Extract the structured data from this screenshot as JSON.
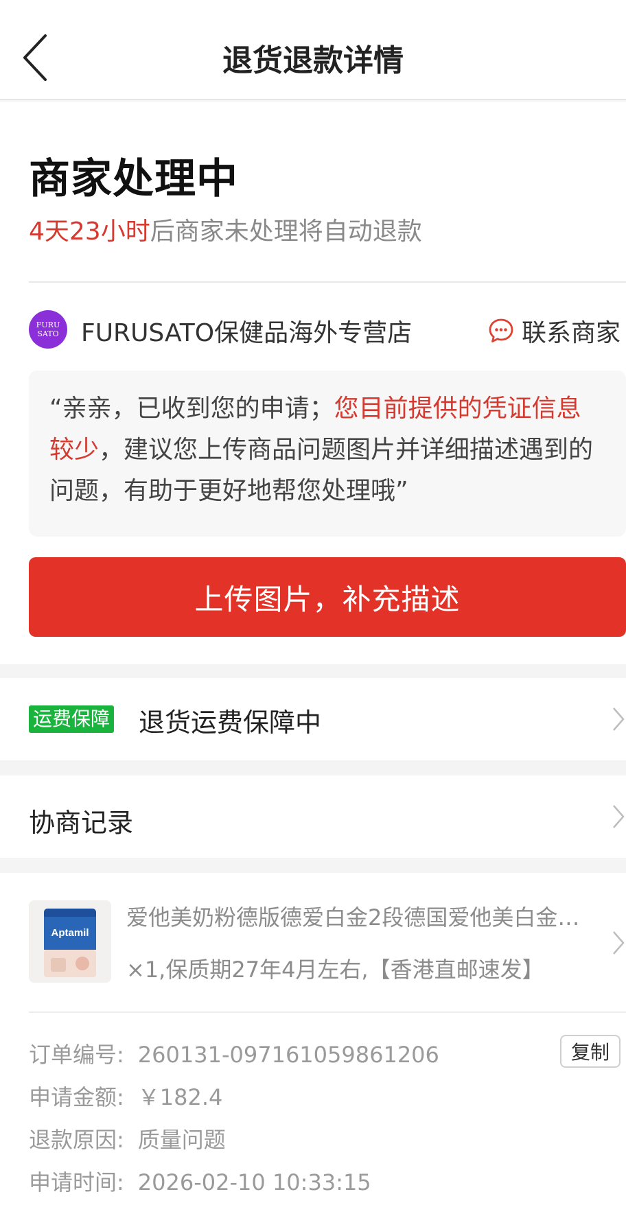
{
  "header": {
    "title": "退货退款详情",
    "back_icon": "chevron-left-icon"
  },
  "status": {
    "title": "商家处理中",
    "countdown": "4天23小时",
    "countdown_suffix": "后商家未处理将自动退款"
  },
  "store": {
    "logo_text_line1": "FURU",
    "logo_text_line2": "SATO",
    "name": "FURUSATO保健品海外专营店",
    "contact_label": "联系商家",
    "contact_icon": "chat-bubble-icon",
    "logo_color": "#8b2fd9"
  },
  "message": {
    "part1": "“亲亲，已收到您的申请；",
    "part2_highlight": "您目前提供的凭证信息较少",
    "part3": "，建议您上传商品问题图片并详细描述遇到的问题，有助于更好地帮您处理哦”"
  },
  "upload_button": {
    "label": "上传图片，补充描述",
    "color": "#e33227"
  },
  "shipping": {
    "badge": "运费保障",
    "text": "退货运费保障中",
    "badge_color": "#19b33d"
  },
  "negotiation": {
    "text": "协商记录"
  },
  "product": {
    "brand_text": "Aptamil",
    "title": "爱他美奶粉德版德爱白金2段德国爱他美白金…",
    "spec": "×1,保质期27年4月左右,【香港直邮速发】"
  },
  "order": {
    "order_no_label": "订单编号:",
    "order_no": "260131-097161059861206",
    "copy_label": "复制",
    "amount_label": "申请金额:",
    "amount": "￥182.4",
    "reason_label": "退款原因:",
    "reason": "质量问题",
    "time_label": "申请时间:",
    "time": "2026-02-10 10:33:15"
  },
  "colors": {
    "accent_red": "#d43a2f",
    "muted_text": "#8a8a8a"
  }
}
